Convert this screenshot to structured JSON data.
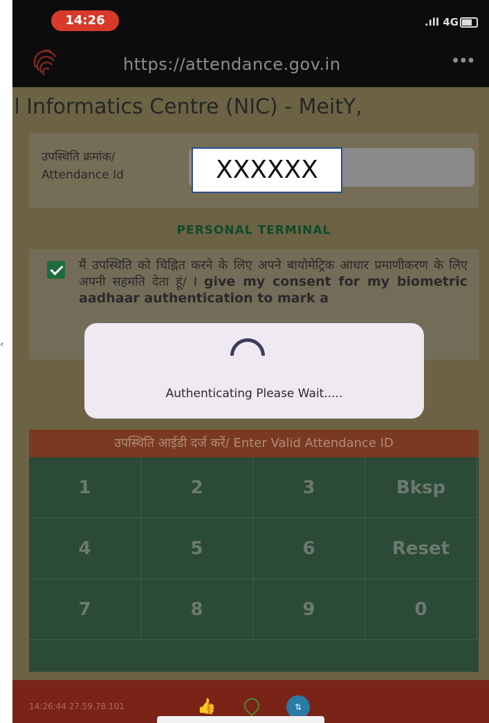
{
  "status": {
    "time": "14:26",
    "network": "4G"
  },
  "browser": {
    "url": "https://attendance.gov.in",
    "menu": "•••"
  },
  "banner": {
    "text": "al Informatics Centre (NIC) - MeitY,"
  },
  "attendance": {
    "label_hi": "उपस्थिति क्रमांक/",
    "label_en": "Attendance Id",
    "value": "XXXXXX"
  },
  "terminal": {
    "title": "PERSONAL TERMINAL"
  },
  "consent": {
    "text_hi": "मैं उपस्थिति को चिह्नित करने के लिए अपने बायोमेट्रिक आधार प्रमाणीकरण के लिए अपनी सहमति देता हूं/ I",
    "text_en": "give my consent for my biometric aadhaar authentication to mark a",
    "checked": true
  },
  "error": {
    "text": "उपस्थिति आईडी दर्ज करें/ Enter Valid Attendance ID"
  },
  "keypad": {
    "k1": "1",
    "k2": "2",
    "k3": "3",
    "k4": "4",
    "k5": "5",
    "k6": "6",
    "k7": "7",
    "k8": "8",
    "k9": "9",
    "k0": "0",
    "bksp": "Bksp",
    "reset": "Reset"
  },
  "dialog": {
    "message": "Authenticating Please Wait....."
  },
  "footer": {
    "info": "14:26:44  27.59.78.101"
  },
  "colors": {
    "header": "#0c0c0c",
    "panel": "#6b6343",
    "keypad": "#2b4a38",
    "footer": "#7a2418"
  }
}
